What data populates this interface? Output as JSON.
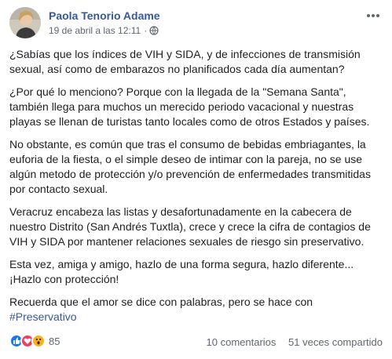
{
  "post": {
    "author": "Paola Tenorio Adame",
    "timestamp": "19 de abril a las 12:11",
    "separator": "·",
    "privacy_icon": "globe-icon",
    "more_icon": "more-options-icon",
    "paragraphs": [
      "¿Sabías que los índices de VIH y SIDA, y de infecciones de transmisión sexual, así como de embarazos no planificados cada día aumentan?",
      "¿Por qué lo menciono? Porque con la llegada de la \"Semana Santa\", también llega para muchos un merecido periodo vacacional y nuestras playas se llenan de turistas tanto locales como de otros Estados y países.",
      "No obstante, es común que tras el consumo de bebidas embriagantes, la euforia de la fiesta, o el simple deseo de intimar con la pareja, no se use algún metodo de protección y/o prevención de enfermedades transmitidas por contacto sexual.",
      "Veracruz encabeza las listas y desafortunadamente en la cabecera de nuestro Distrito (San Andrés Tuxtla), crece y crece la cifra de contagios de VIH y SIDA por mantener relaciones sexuales de riesgo sin preservativo.",
      "Esta vez, amiga y amigo, hazlo de una forma segura, hazlo diferente... ¡Hazlo con protección!"
    ],
    "last_paragraph_text": "Recuerda que el amor se dice con palabras, pero se hace con",
    "hashtag": "#Preservativo"
  },
  "footer": {
    "reaction_icons": [
      "like-icon",
      "love-icon",
      "wow-icon"
    ],
    "reaction_count": "85",
    "comments": "10 comentarios",
    "shares": "51 veces compartido"
  },
  "colors": {
    "link": "#385898",
    "text": "#1c1e21",
    "meta": "#606770",
    "like": "#1877f2",
    "love": "#f33e58",
    "wow": "#f7b125"
  }
}
